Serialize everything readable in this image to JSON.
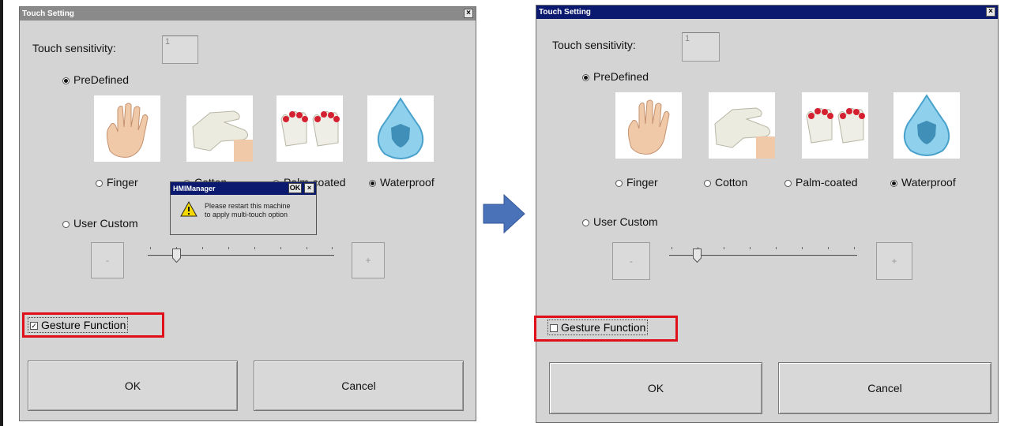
{
  "colors": {
    "highlight": "#e0101a",
    "arrow": "#4a72b8",
    "active_title": "#0b1a6e",
    "inactive_title": "#8a8a8a"
  },
  "before": {
    "window_title": "Touch Setting",
    "close_glyph": "×",
    "sensitivity_label": "Touch sensitivity:",
    "sensitivity_value": "1",
    "predefined_label": "PreDefined",
    "options": {
      "finger": "Finger",
      "cotton": "Cotton",
      "palm": "Palm-coated",
      "waterproof": "Waterproof"
    },
    "user_custom_label": "User Custom",
    "minus_label": "-",
    "plus_label": "+",
    "gesture_label": "Gesture Function",
    "gesture_checked": true,
    "ok_label": "OK",
    "cancel_label": "Cancel",
    "dialog": {
      "title": "HMIManager",
      "ok_label": "OK",
      "close_glyph": "×",
      "message_line1": "Please restart this machine",
      "message_line2": "to apply multi-touch option"
    }
  },
  "after": {
    "window_title": "Touch Setting",
    "close_glyph": "×",
    "sensitivity_label": "Touch sensitivity:",
    "sensitivity_value": "1",
    "predefined_label": "PreDefined",
    "options": {
      "finger": "Finger",
      "cotton": "Cotton",
      "palm": "Palm-coated",
      "waterproof": "Waterproof"
    },
    "user_custom_label": "User Custom",
    "minus_label": "-",
    "plus_label": "+",
    "gesture_label": "Gesture Function",
    "gesture_checked": false,
    "ok_label": "OK",
    "cancel_label": "Cancel"
  },
  "icons": {
    "finger": "hand-icon",
    "cotton": "cotton-glove-icon",
    "palm": "palm-coated-gloves-icon",
    "waterproof": "water-drop-shield-icon",
    "warning": "warning-icon",
    "arrow": "right-arrow-icon"
  }
}
